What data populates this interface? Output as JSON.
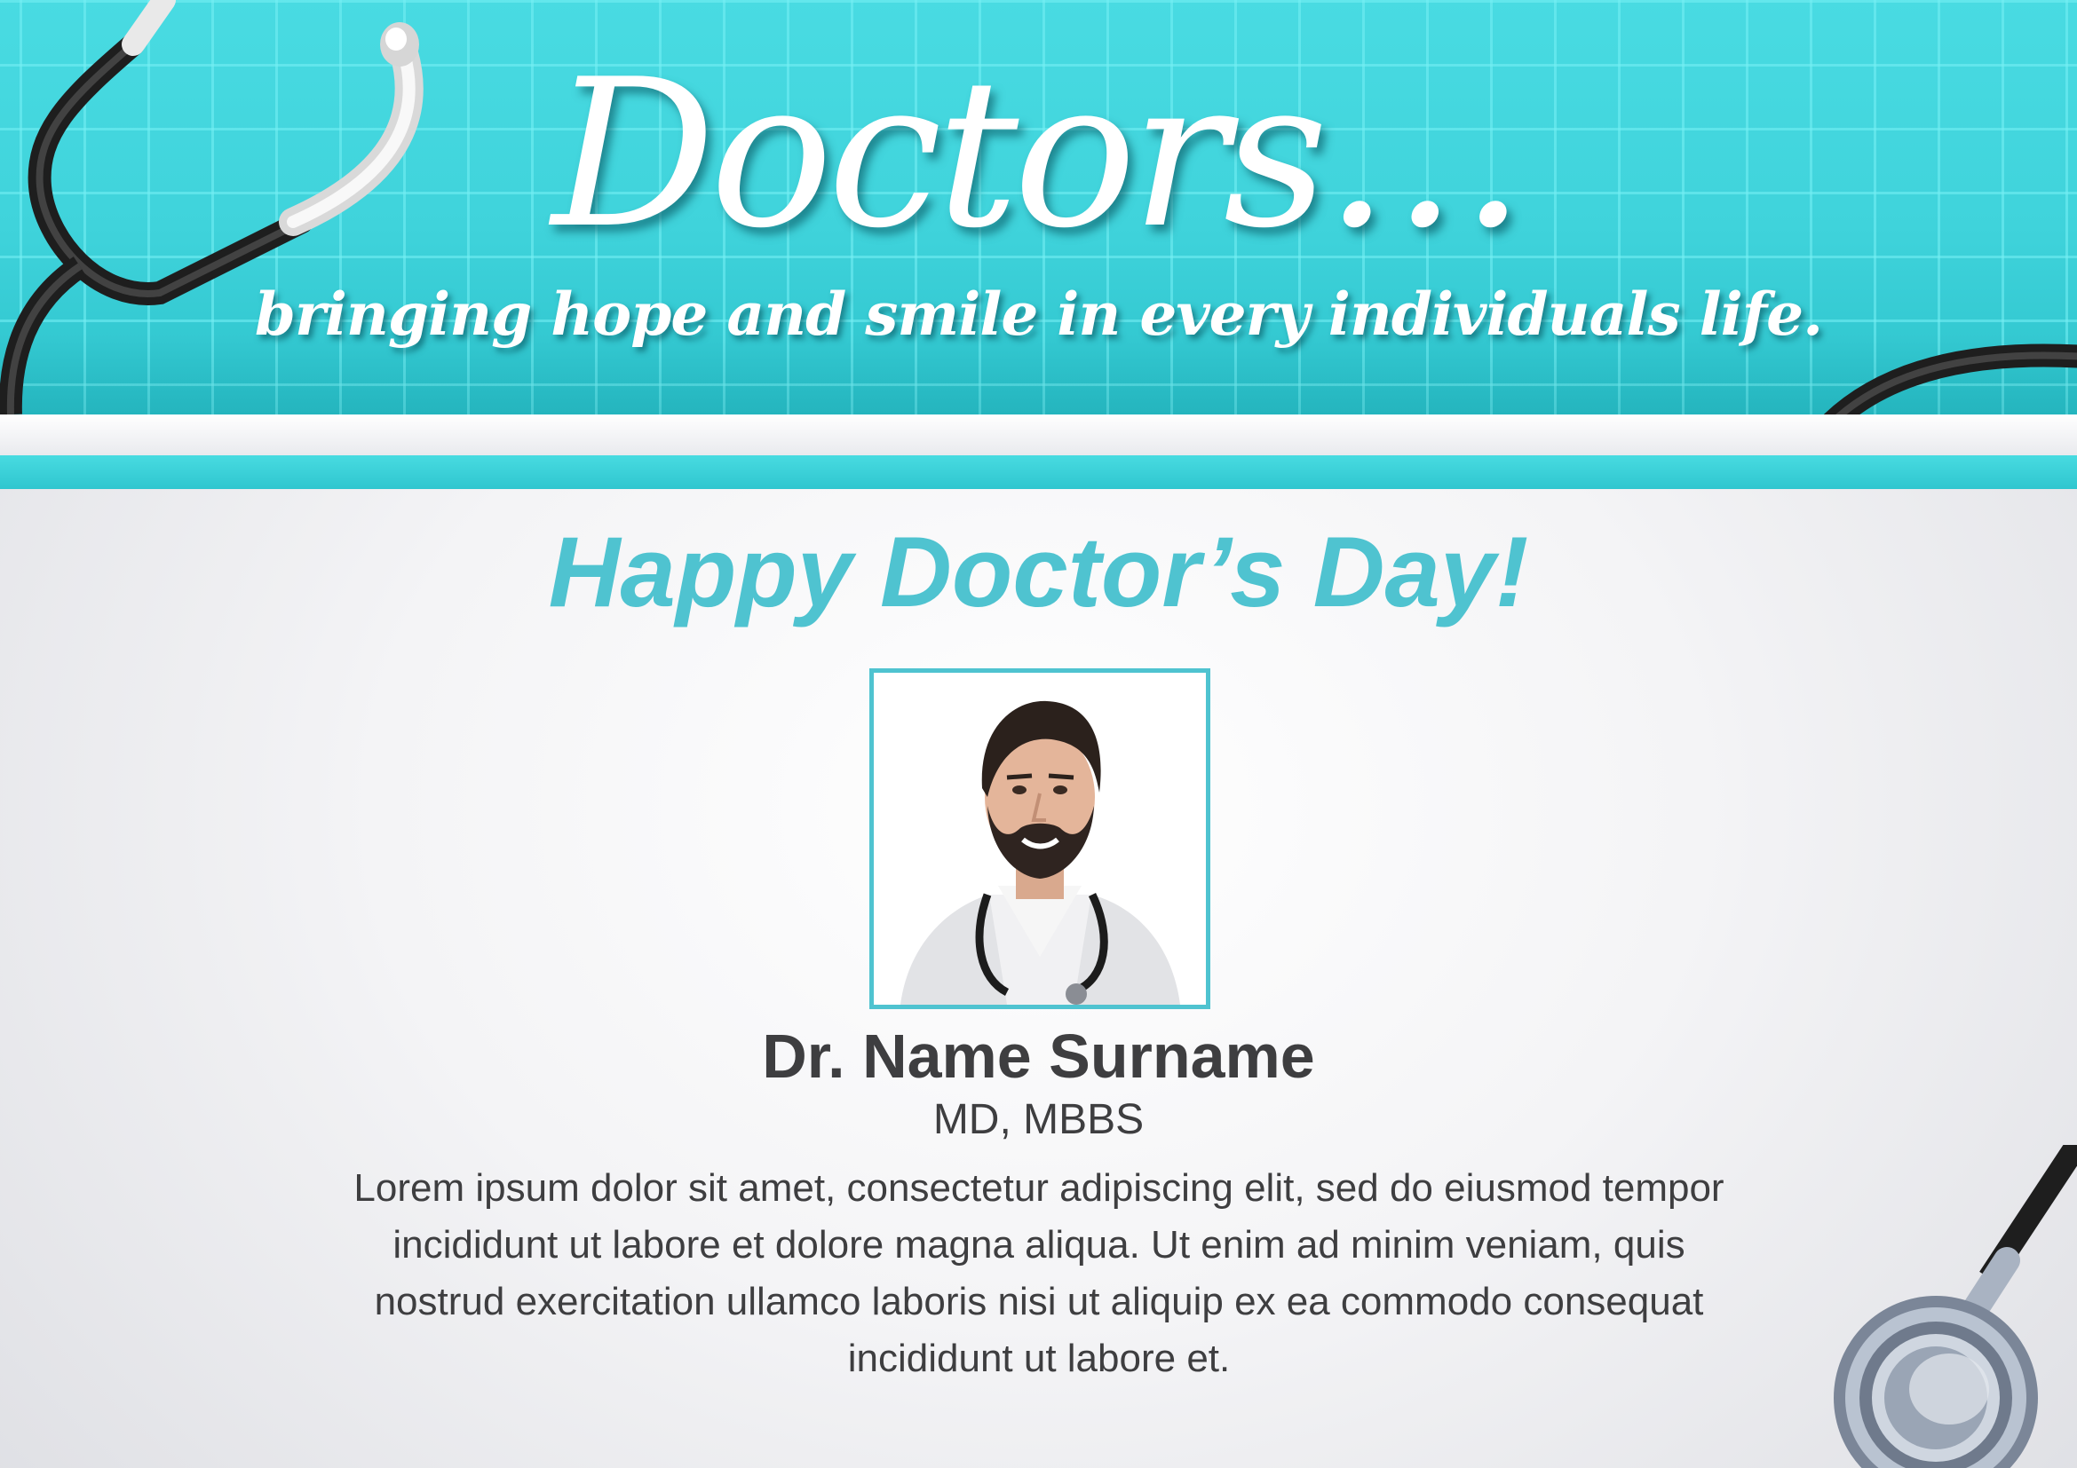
{
  "banner": {
    "title": "Doctors…",
    "tagline": "bringing hope and smile in every individuals life.",
    "background_color": "#3fd3db"
  },
  "greeting": {
    "text": "Happy Doctor’s Day!",
    "color": "#4fc3d0"
  },
  "profile": {
    "photo_alt": "doctor-portrait",
    "name": "Dr. Name Surname",
    "credentials": "MD, MBBS",
    "bio": "Lorem ipsum dolor sit amet, consectetur adipiscing elit, sed do eiusmod tempor incididunt ut labore et dolore magna aliqua. Ut enim ad minim veniam, quis nostrud exercitation ullamco laboris nisi ut aliquip ex ea commodo consequat incididunt ut labore et."
  },
  "decorations": {
    "top_left": "stethoscope-tube-icon",
    "top_right": "stethoscope-tube-icon",
    "bottom_right": "stethoscope-chestpiece-icon"
  }
}
